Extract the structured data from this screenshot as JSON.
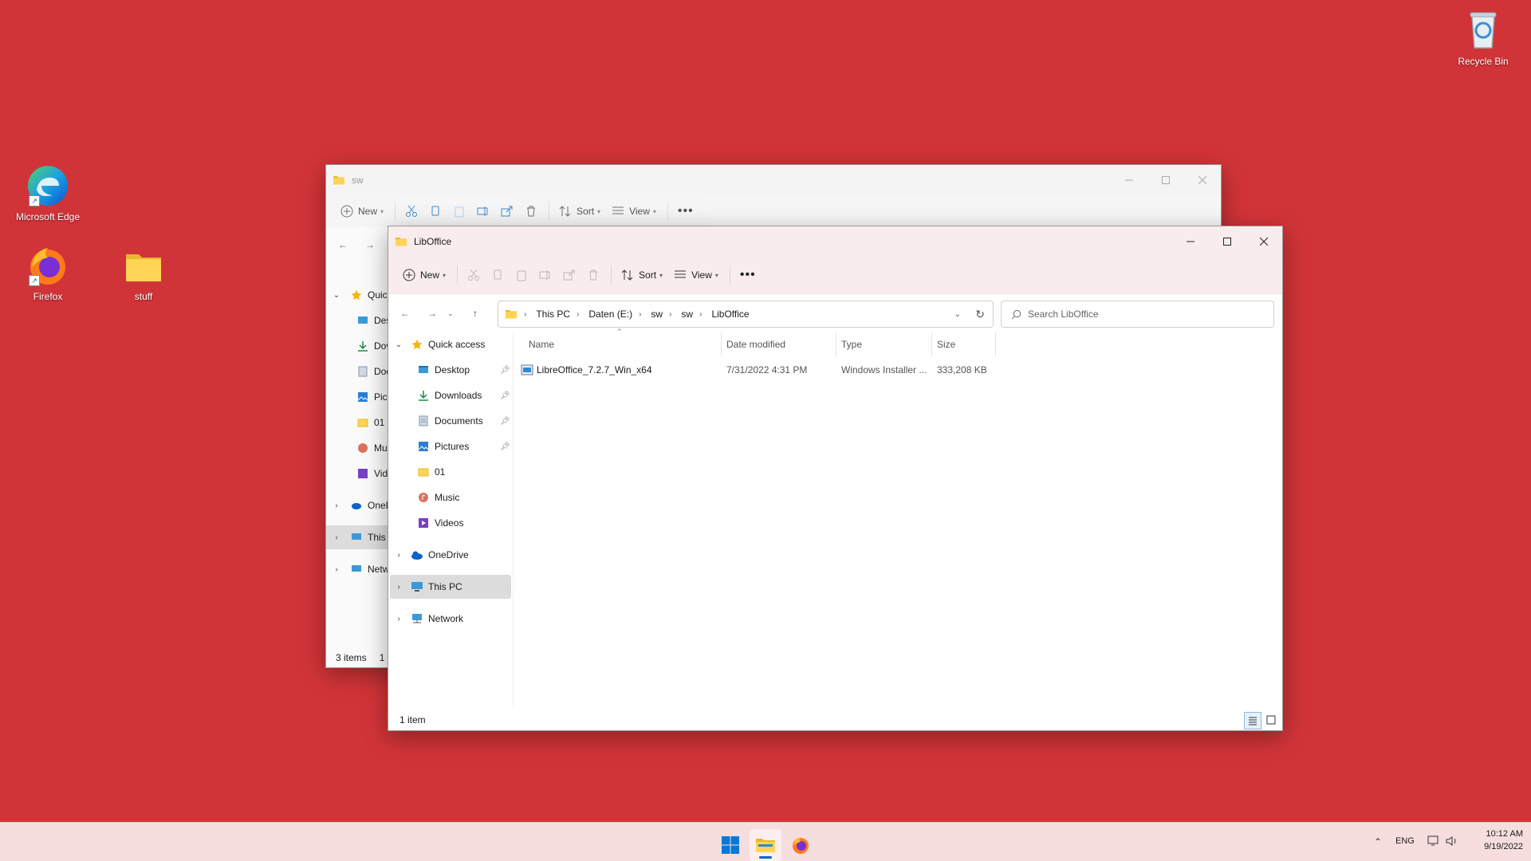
{
  "desktop": {
    "icons": [
      {
        "label": "Recycle Bin"
      },
      {
        "label": "Microsoft Edge"
      },
      {
        "label": "Firefox"
      },
      {
        "label": "stuff"
      }
    ]
  },
  "back_window": {
    "title": "sw",
    "toolbar": {
      "new_label": "New",
      "sort_label": "Sort",
      "view_label": "View"
    },
    "sidebar": [
      "Quic",
      "Des",
      "Dov",
      "Doc",
      "Pict",
      "01",
      "Mu",
      "Vide",
      "OneD",
      "This I",
      "Netw"
    ],
    "status": "3 items",
    "status_extra": "1"
  },
  "front_window": {
    "title": "LibOffice",
    "toolbar": {
      "new_label": "New",
      "sort_label": "Sort",
      "view_label": "View"
    },
    "breadcrumbs": [
      "This PC",
      "Daten (E:)",
      "sw",
      "sw",
      "LibOffice"
    ],
    "search_placeholder": "Search LibOffice",
    "sidebar": {
      "quick_access": "Quick access",
      "items": [
        {
          "label": "Desktop",
          "pinned": true
        },
        {
          "label": "Downloads",
          "pinned": true
        },
        {
          "label": "Documents",
          "pinned": true
        },
        {
          "label": "Pictures",
          "pinned": true
        },
        {
          "label": "01",
          "pinned": false
        },
        {
          "label": "Music",
          "pinned": false
        },
        {
          "label": "Videos",
          "pinned": false
        }
      ],
      "onedrive": "OneDrive",
      "this_pc": "This PC",
      "network": "Network"
    },
    "columns": {
      "name": "Name",
      "date": "Date modified",
      "type": "Type",
      "size": "Size"
    },
    "files": [
      {
        "name": "LibreOffice_7.2.7_Win_x64",
        "date": "7/31/2022 4:31 PM",
        "type": "Windows Installer ...",
        "size": "333,208 KB"
      }
    ],
    "status": "1 item"
  },
  "taskbar": {
    "lang": "ENG",
    "time": "10:12 AM",
    "date": "9/19/2022"
  },
  "colors": {
    "desktop": "#d13438",
    "accent": "#0067c0"
  }
}
